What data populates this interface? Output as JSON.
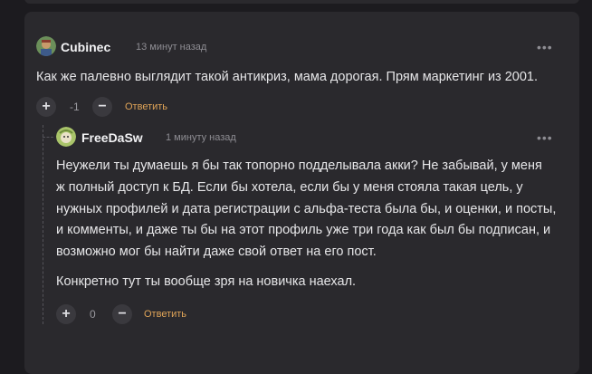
{
  "comments": [
    {
      "author": "Cubinec",
      "time": "13 минут назад",
      "text": "Как же палевно выглядит такой антикриз, мама дорогая.  Прям маркетинг из 2001.",
      "score": "-1",
      "reply_label": "Ответить",
      "more_icon": "more-horizontal-icon",
      "upvote_label": "+",
      "downvote_label": "−"
    },
    {
      "author": "FreeDaSw",
      "time": "1 минуту назад",
      "lines": [
        "Неужели ты думаешь я бы так топорно подделывала акки? Не забывай, у меня",
        "ж полный доступ к БД. Если бы хотела, если бы у меня стояла такая цель, у",
        "нужных профилей и дата регистрации с альфа-теста была бы, и оценки, и посты,",
        "и комменты, и даже ты бы на этот профиль уже три года как был бы подписан, и",
        "возможно мог бы найти даже свой ответ на его пост."
      ],
      "paragraph2": "Конкретно тут ты вообще зря на новичка наехал.",
      "score": "0",
      "reply_label": "Ответить",
      "more_icon": "more-horizontal-icon",
      "upvote_label": "+",
      "downvote_label": "−"
    }
  ],
  "colors": {
    "background": "#1c1b1f",
    "card": "#2a292d",
    "accent_link": "#e0a458",
    "muted": "#8e8d93"
  }
}
